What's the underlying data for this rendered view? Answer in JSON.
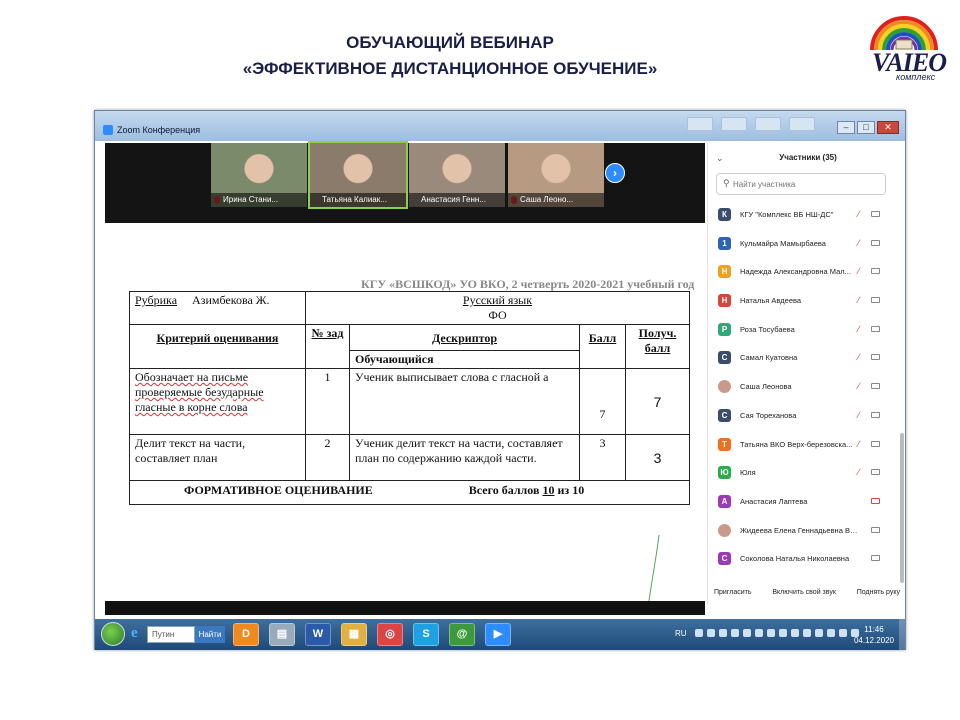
{
  "slide": {
    "title_line1": "ОБУЧАЮЩИЙ ВЕБИНАР",
    "title_line2": "«ЭФФЕКТИВНОЕ ДИСТАНЦИОННОЕ ОБУЧЕНИЕ»",
    "logo_text": "VAIEO",
    "logo_sub": "комплекс"
  },
  "window": {
    "title": "Zoom Конференция",
    "controls": [
      "–",
      "□",
      "✕"
    ]
  },
  "video_tiles": [
    {
      "name": "Ирина Стани...",
      "muted": true,
      "color": "#7a8a6a"
    },
    {
      "name": "Татьяна Калиак...",
      "muted": false,
      "color": "#8a7b6b"
    },
    {
      "name": "Анастасия Генн...",
      "muted": false,
      "color": "#9a8a7c"
    },
    {
      "name": "Саша Леоно...",
      "muted": true,
      "color": "#b69a82"
    }
  ],
  "document": {
    "header": "КГУ «ВСШКОД» УО ВКО, 2 четверть 2020-2021 учебный год",
    "rubric_label": "Рубрика",
    "teacher": "Азимбекова Ж.",
    "subject": "Русский язык",
    "fo": "ФО",
    "col_criteria": "Критерий оценивания",
    "col_num": "№ зад",
    "col_descriptor": "Дескриптор",
    "col_score": "Балл",
    "col_received": "Получ. балл",
    "student_label": "Обучающийся",
    "rows": [
      {
        "criterion": "Обозначает на письме проверяемые безударные гласные в корне слова",
        "num": "1",
        "descriptor": "Ученик выписывает слова с гласной а",
        "score": "7",
        "received": "7"
      },
      {
        "criterion": "Делит текст на части, составляет план",
        "num": "2",
        "descriptor": "Ученик делит текст на части, составляет план по содержанию каждой части.",
        "score": "3",
        "received": "3"
      }
    ],
    "footer_title": "ФОРМАТИВНОЕ ОЦЕНИВАНИЕ",
    "footer_total_prefix": "Всего баллов",
    "footer_total_value": "10",
    "footer_total_suffix": "из 10"
  },
  "participants": {
    "title": "Участники (35)",
    "search_placeholder": "Найти участника",
    "list": [
      {
        "initial": "К",
        "color": "#3a4d6e",
        "name": "КГУ \"Комплекс ВБ НШ-ДС\"",
        "mic_off": true,
        "cam_off": false
      },
      {
        "initial": "1",
        "color": "#2a63b8",
        "name": "Кульмайра Мамырбаева",
        "mic_off": true,
        "cam_off": false
      },
      {
        "initial": "Н",
        "color": "#f0a020",
        "name": "Надежда Александровна Мал...",
        "mic_off": true,
        "cam_off": false
      },
      {
        "initial": "Н",
        "color": "#d8453a",
        "name": "Наталья Авдеева",
        "mic_off": true,
        "cam_off": false
      },
      {
        "initial": "Р",
        "color": "#2eaa7a",
        "name": "Роза Тосубаева",
        "mic_off": true,
        "cam_off": false
      },
      {
        "initial": "С",
        "color": "#3a4d6e",
        "name": "Самал Куатовна",
        "mic_off": true,
        "cam_off": false
      },
      {
        "initial": "",
        "color": "photo",
        "name": "Саша Леонова",
        "mic_off": true,
        "cam_off": false
      },
      {
        "initial": "С",
        "color": "#3a4d6e",
        "name": "Сая Тореханова",
        "mic_off": true,
        "cam_off": false
      },
      {
        "initial": "Т",
        "color": "#f07020",
        "name": "Татьяна ВКО Верх-березовска...",
        "mic_off": true,
        "cam_off": false
      },
      {
        "initial": "Ю",
        "color": "#2eaa4a",
        "name": "Юля",
        "mic_off": true,
        "cam_off": false
      },
      {
        "initial": "А",
        "color": "#9a3ab8",
        "name": "Анастасия Лаптева",
        "mic_off": false,
        "cam_off": true
      },
      {
        "initial": "",
        "color": "photo",
        "name": "Жидеева Елена Геннадьевна ВКО",
        "mic_off": false,
        "cam_off": false
      },
      {
        "initial": "С",
        "color": "#9a3ab8",
        "name": "Соколова Наталья Николаевна",
        "mic_off": false,
        "cam_off": false
      }
    ],
    "footer": {
      "invite": "Пригласить",
      "unmute": "Включить свой звук",
      "raise_hand": "Поднять руку"
    }
  },
  "taskbar": {
    "search_text": "Путин",
    "go_label": "Найти",
    "apps": [
      "D",
      "▤",
      "W",
      "▦",
      "◎",
      "S",
      "@",
      "▶"
    ],
    "lang": "RU",
    "time": "11:46",
    "date": "04.12.2020"
  }
}
